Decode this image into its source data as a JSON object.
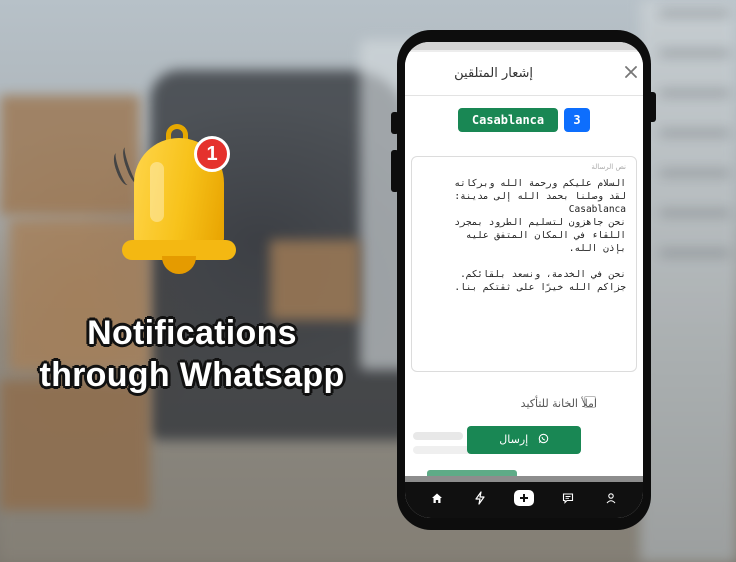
{
  "promo": {
    "headline_line1": "Notifications",
    "headline_line2": "through Whatsapp",
    "badge_count": "1",
    "accent_color": "#f7c21a",
    "badge_color": "#e5322d"
  },
  "modal": {
    "title": "إشعار المتلقين",
    "city": "Casablanca",
    "count": "3",
    "message_label": "نص الرسالة",
    "message_text": "السلام عليكم ورحمة الله وبركاته\nلقد وصلنا بحمد الله إلى مدينة:\nCasablanca\nنحن جاهزون لتسليم الطرود بمجرد\nاللقاء في المكان المتفق عليه\nبإذن الله.\n\nنحن في الخدمة، ونسعد بلقائكم.\nجزاكم الله خيرًا على ثقتكم بنا.",
    "confirm_label": "املأ الخانة للتأكيد",
    "send_label": "إرسال",
    "colors": {
      "success": "#198754",
      "primary": "#0d6efd"
    }
  },
  "nav": {
    "items": [
      "home-icon",
      "bolt-icon",
      "plus-icon",
      "message-icon",
      "user-icon"
    ]
  }
}
